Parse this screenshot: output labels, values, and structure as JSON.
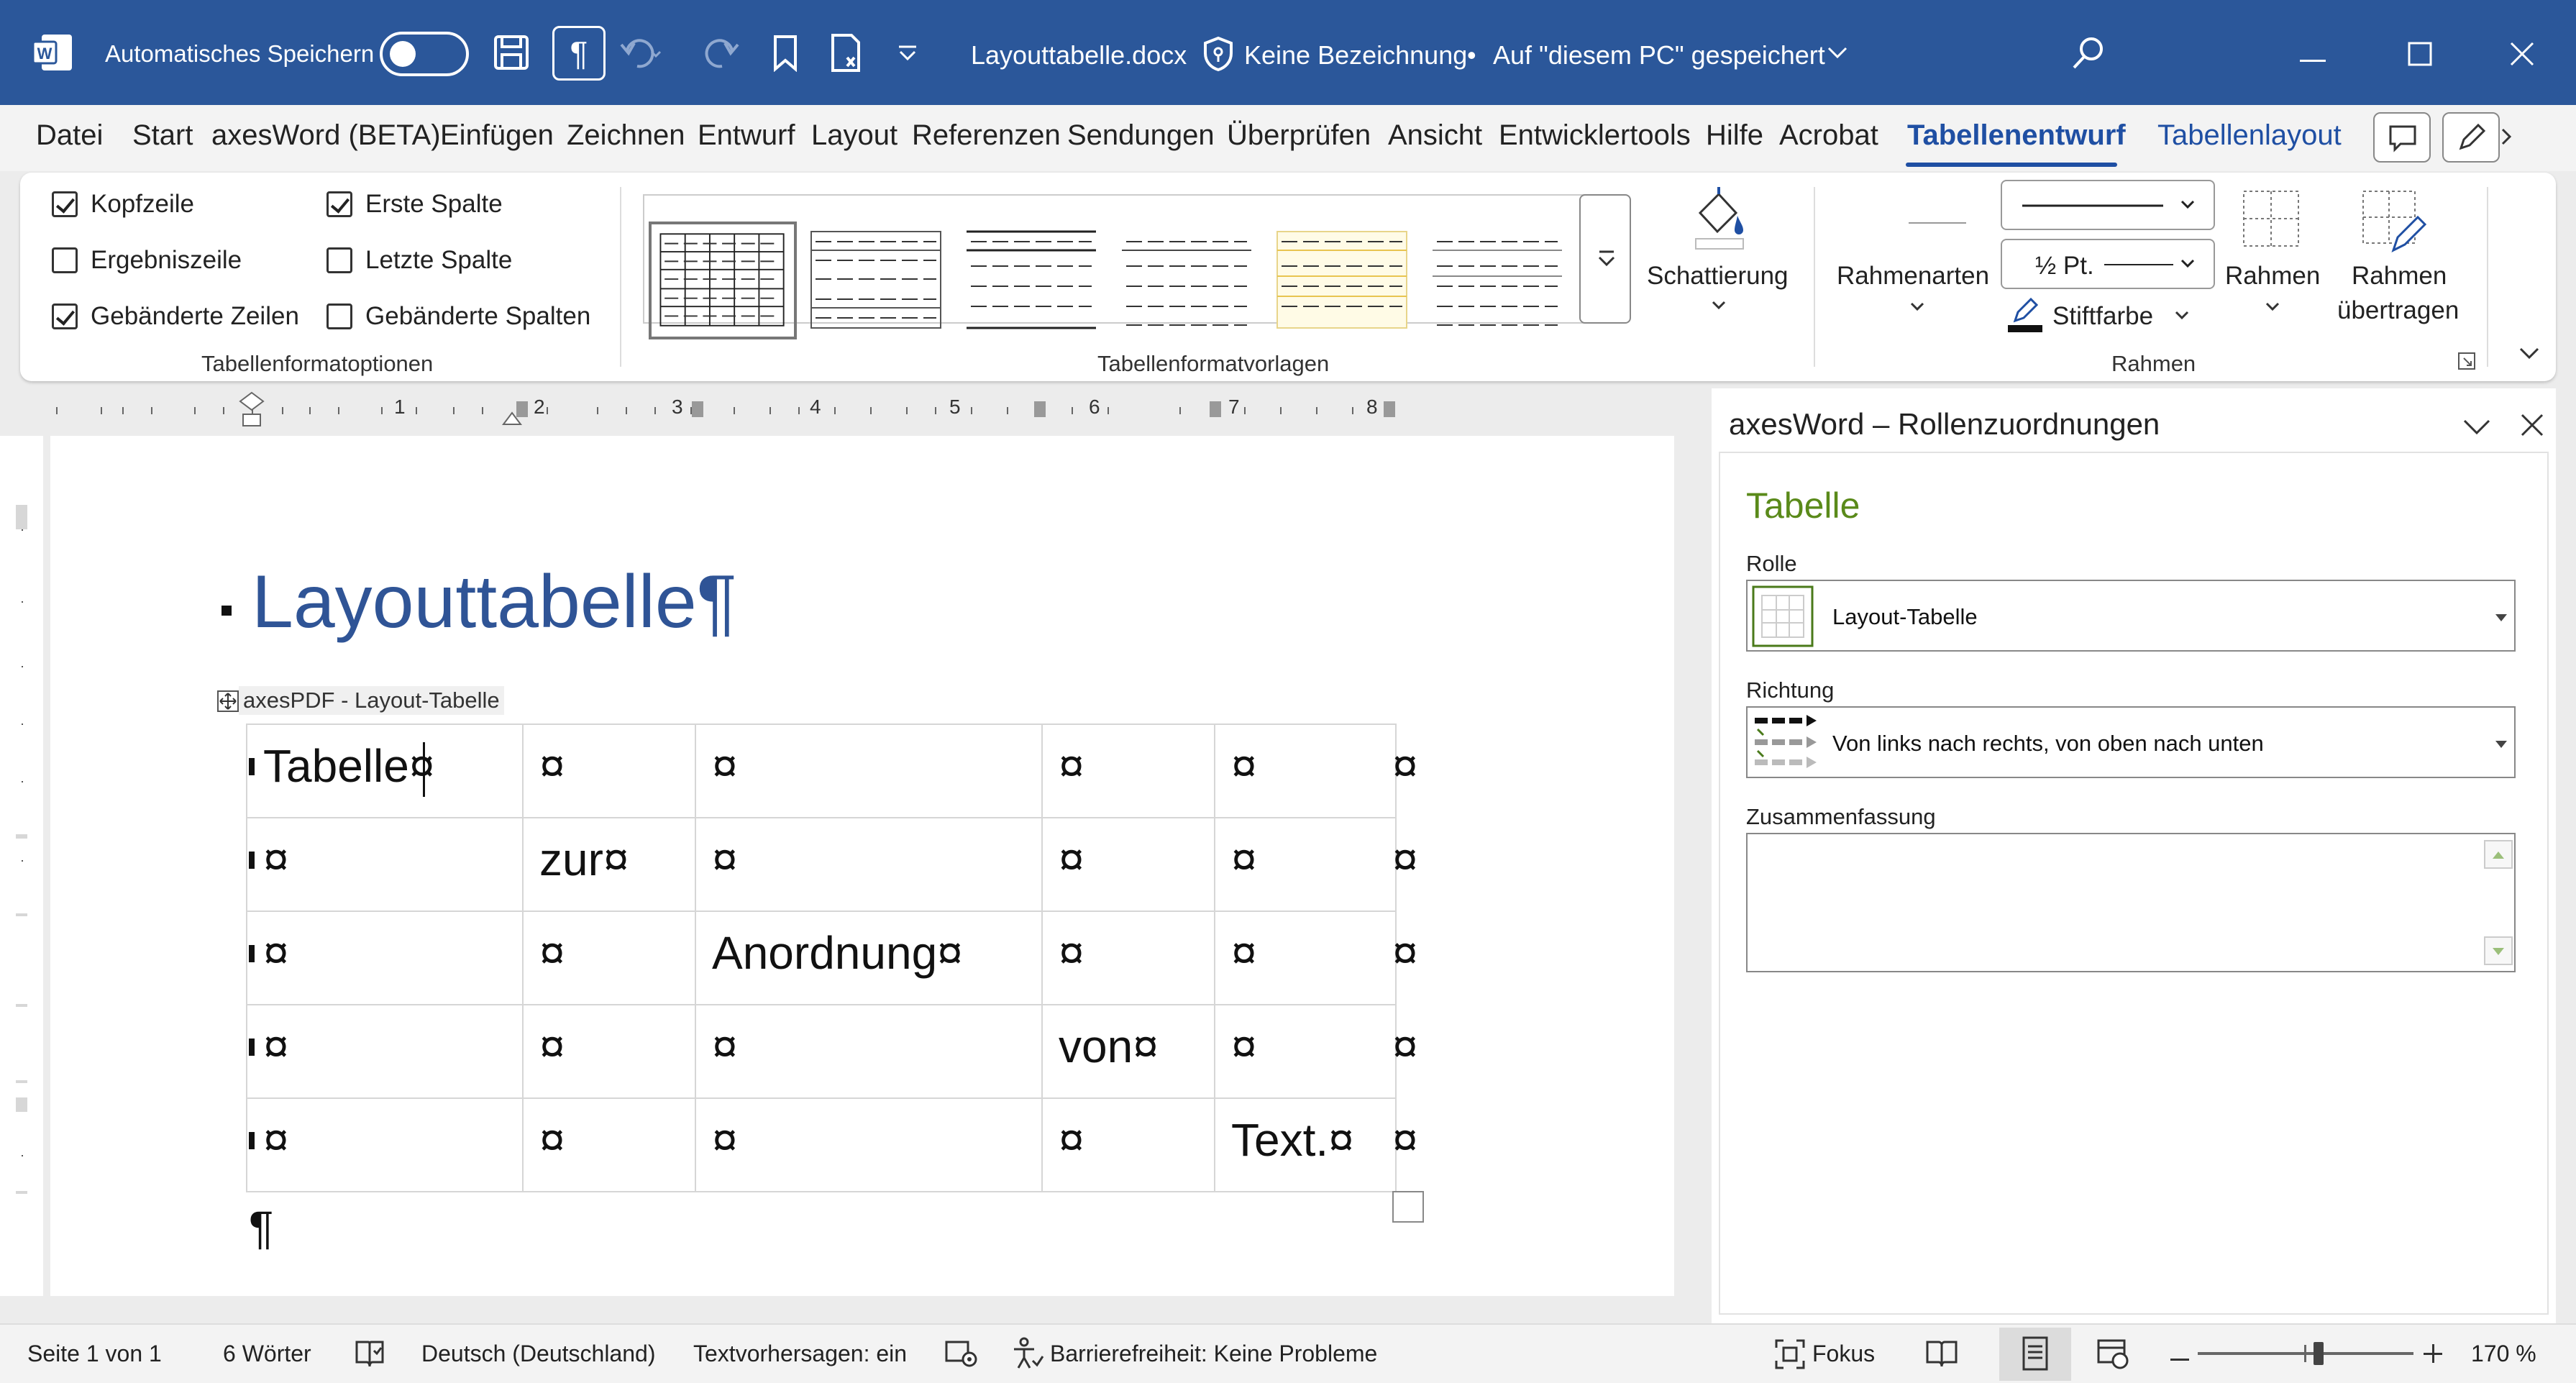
{
  "window": {
    "autosave_label": "Automatisches Speichern",
    "filename": "Layouttabelle.docx",
    "sensitivity": "Keine Bezeichnung",
    "save_location": "Auf \"diesem PC\" gespeichert",
    "separator": "•"
  },
  "menu": {
    "items": [
      "Datei",
      "Start",
      "axesWord (BETA)",
      "Einfügen",
      "Zeichnen",
      "Entwurf",
      "Layout",
      "Referenzen",
      "Sendungen",
      "Überprüfen",
      "Ansicht",
      "Entwicklertools",
      "Hilfe",
      "Acrobat",
      "Tabellenentwurf",
      "Tabellenlayout"
    ]
  },
  "ribbon": {
    "options": [
      {
        "label": "Kopfzeile",
        "checked": true
      },
      {
        "label": "Ergebniszeile",
        "checked": false
      },
      {
        "label": "Gebänderte Zeilen",
        "checked": true
      },
      {
        "label": "Erste Spalte",
        "checked": true
      },
      {
        "label": "Letzte Spalte",
        "checked": false
      },
      {
        "label": "Gebänderte Spalten",
        "checked": false
      }
    ],
    "group_options": "Tabellenformatoptionen",
    "group_styles": "Tabellenformatvorlagen",
    "group_borders": "Rahmen",
    "shading": "Schattierung",
    "border_styles": "Rahmenarten",
    "pen_weight": "½ Pt.",
    "pen_color": "Stiftfarbe",
    "borders": "Rahmen",
    "border_painter_1": "Rahmen",
    "border_painter_2": "übertragen"
  },
  "ruler": {
    "numbers": [
      "1",
      "2",
      "3",
      "4",
      "5",
      "6",
      "7",
      "8"
    ]
  },
  "document": {
    "heading": "Layouttabelle¶",
    "table_label": "axesPDF - Layout-Tabelle",
    "cell_marker": "¤",
    "cells": [
      [
        "Tabelle¤",
        "¤",
        "¤",
        "¤",
        "¤",
        "¤"
      ],
      [
        "¤",
        "zur¤",
        "¤",
        "¤",
        "¤",
        "¤"
      ],
      [
        "¤",
        "¤",
        "Anordnung¤",
        "¤",
        "¤",
        "¤"
      ],
      [
        "¤",
        "¤",
        "¤",
        "von¤",
        "¤",
        "¤"
      ],
      [
        "¤",
        "¤",
        "¤",
        "¤",
        "Text.¤",
        "¤"
      ]
    ],
    "end_mark": "¶"
  },
  "pane": {
    "title": "axesWord – Rollenzuordnungen",
    "section": "Tabelle",
    "role_label": "Rolle",
    "role_value": "Layout-Tabelle",
    "direction_label": "Richtung",
    "direction_value": "Von links nach rechts, von oben nach unten",
    "summary_label": "Zusammenfassung",
    "summary_value": ""
  },
  "status": {
    "page": "Seite 1 von 1",
    "words": "6 Wörter",
    "language": "Deutsch (Deutschland)",
    "predictions": "Textvorhersagen: ein",
    "accessibility": "Barrierefreiheit: Keine Probleme",
    "focus": "Fokus",
    "zoom": "170 %",
    "zoom_fraction": 0.56
  },
  "colors": {
    "titlebar": "#2b579a",
    "accent": "#1f4fa3",
    "heading": "#2f5496",
    "pane_section": "#5a8a1a"
  }
}
